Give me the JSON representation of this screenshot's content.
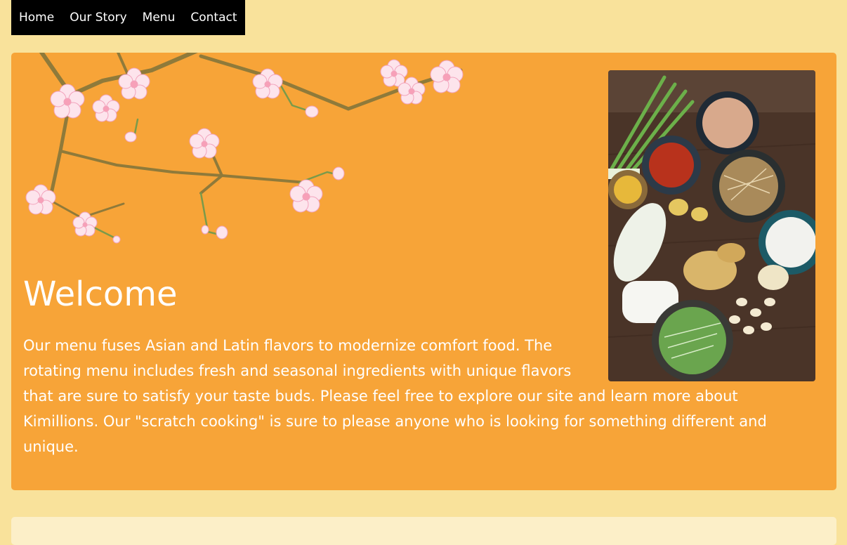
{
  "nav": {
    "items": [
      {
        "label": "Home"
      },
      {
        "label": "Our Story"
      },
      {
        "label": "Menu"
      },
      {
        "label": "Contact"
      }
    ]
  },
  "hero": {
    "title": "Welcome",
    "body": "Our menu fuses Asian and Latin flavors to modernize comfort food. The rotating menu includes fresh and seasonal ingredients with unique flavors that are sure to satisfy your taste buds. Please feel free to explore our site and learn more about Kimillions. Our \"scratch cooking\" is sure to please anyone who is looking for something different and unique."
  },
  "colors": {
    "page_background": "#f9e29b",
    "nav_background": "#000000",
    "hero_background": "#f7a438",
    "text": "#ffffff"
  }
}
